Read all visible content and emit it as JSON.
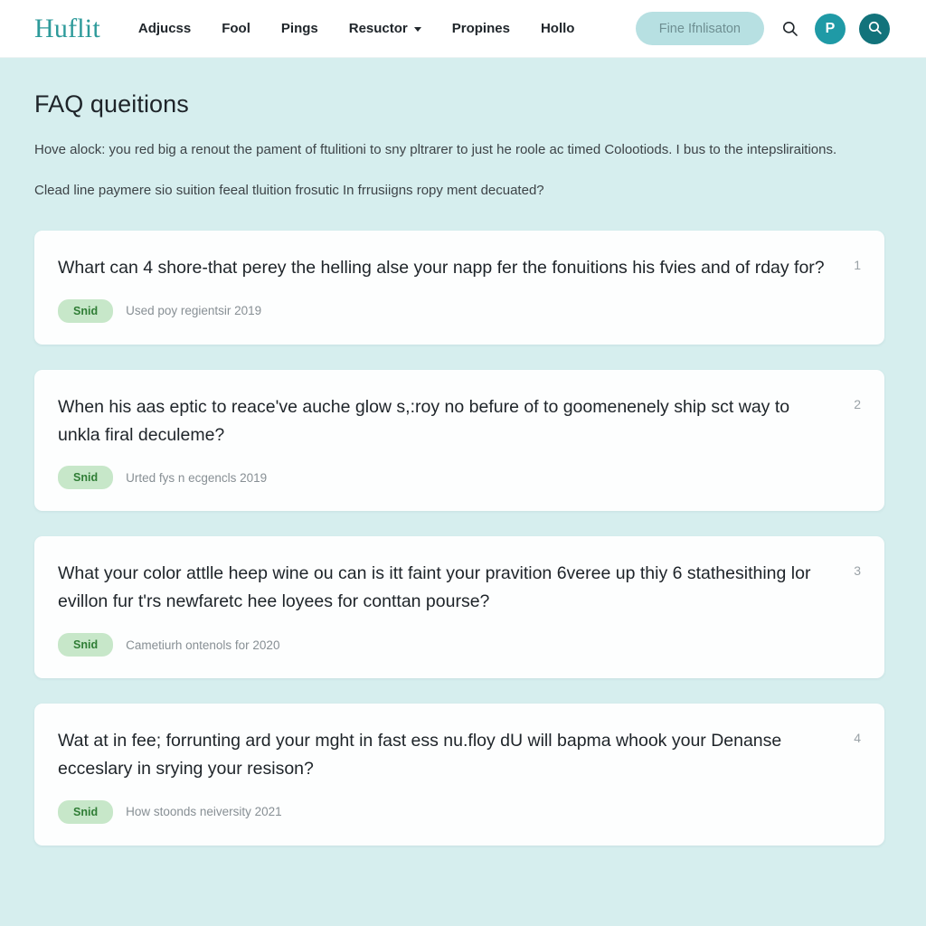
{
  "colors": {
    "page_background": "#d6eeee",
    "header_background": "#ffffff",
    "logo_teal": "#2d9a9a",
    "pill_teal": "#b7e0e2",
    "avatar_teal": "#1f9aa6",
    "search_teal": "#12737b",
    "badge_green_bg": "#c7e7c9",
    "badge_green_text": "#2f7d35",
    "card_background": "#fdfefe"
  },
  "header": {
    "logo": "Huflit",
    "nav": [
      {
        "label": "Adjucss",
        "has_caret": false
      },
      {
        "label": "Fool",
        "has_caret": false
      },
      {
        "label": "Pings",
        "has_caret": false
      },
      {
        "label": "Resuctor",
        "has_caret": true
      },
      {
        "label": "Propines",
        "has_caret": false
      },
      {
        "label": "Hollo",
        "has_caret": false
      }
    ],
    "cta_label": "Fine Ifnlisaton",
    "search_icon": "search-icon",
    "avatar_initial": "P",
    "avatar_icon": "avatar-icon",
    "search_circle_icon": "search-icon"
  },
  "main": {
    "title": "FAQ queitions",
    "intro_paragraph": "Hove alock: you red big a renout the pament of ftulitioni to sny pltrarer to just he roole ac timed Colootiods. I bus to the intepsliraitions.",
    "intro_question": "Clead line paymere sio suition feeal tluition frosutic In frrusiigns ropy ment decuated?",
    "faq_items": [
      {
        "index": "1",
        "question": "Whart can 4 shore-that perey the helling alse your napp fer the fonuitions his fvies and of rday for?",
        "badge": "Snid",
        "meta": "Used poy regientsir 2019"
      },
      {
        "index": "2",
        "question": "When his aas eptic to reace've auche glow s,:roy no befure of to goomenenely ship sct way to unkla firal deculeme?",
        "badge": "Snid",
        "meta": "Urted fys n ecgencls 2019"
      },
      {
        "index": "3",
        "question": "What your color attlle heep wine ou can is itt faint your pravition 6veree up thiy 6 stathesithing lor evillon fur t'rs newfaretc hee loyees for conttan pourse?",
        "badge": "Snid",
        "meta": "Cametiurh ontenols for 2020"
      },
      {
        "index": "4",
        "question": "Wat at in fee; forrunting ard your mght in fast ess nu.floy dU will bapma whook your Denanse ecceslary in srying your resison?",
        "badge": "Snid",
        "meta": "How stoonds neiversity 2021"
      }
    ]
  }
}
